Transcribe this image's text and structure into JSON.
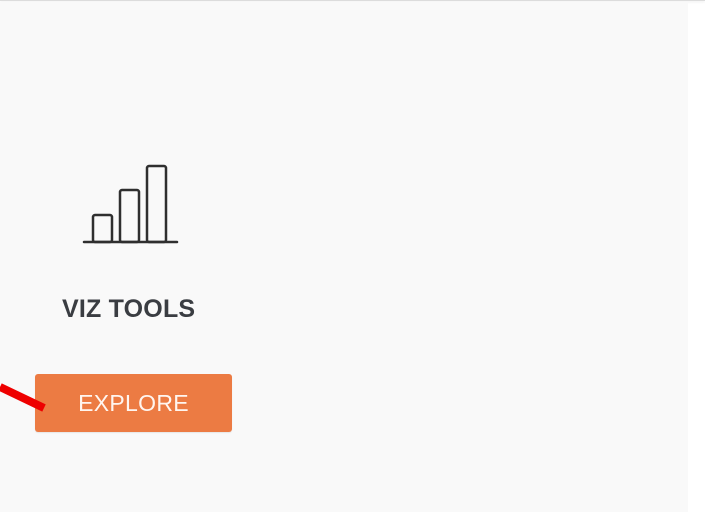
{
  "card": {
    "icon": "bar-chart-icon",
    "title": "VIZ TOOLS",
    "button_label": "EXPLORE"
  },
  "colors": {
    "panel_background": "#f9f9f9",
    "title_text": "#3a3d42",
    "button_background": "#ec7b43",
    "button_text": "#fff5ef",
    "icon_stroke": "#2f2f2f",
    "annotation_arrow": "#ee0000"
  }
}
